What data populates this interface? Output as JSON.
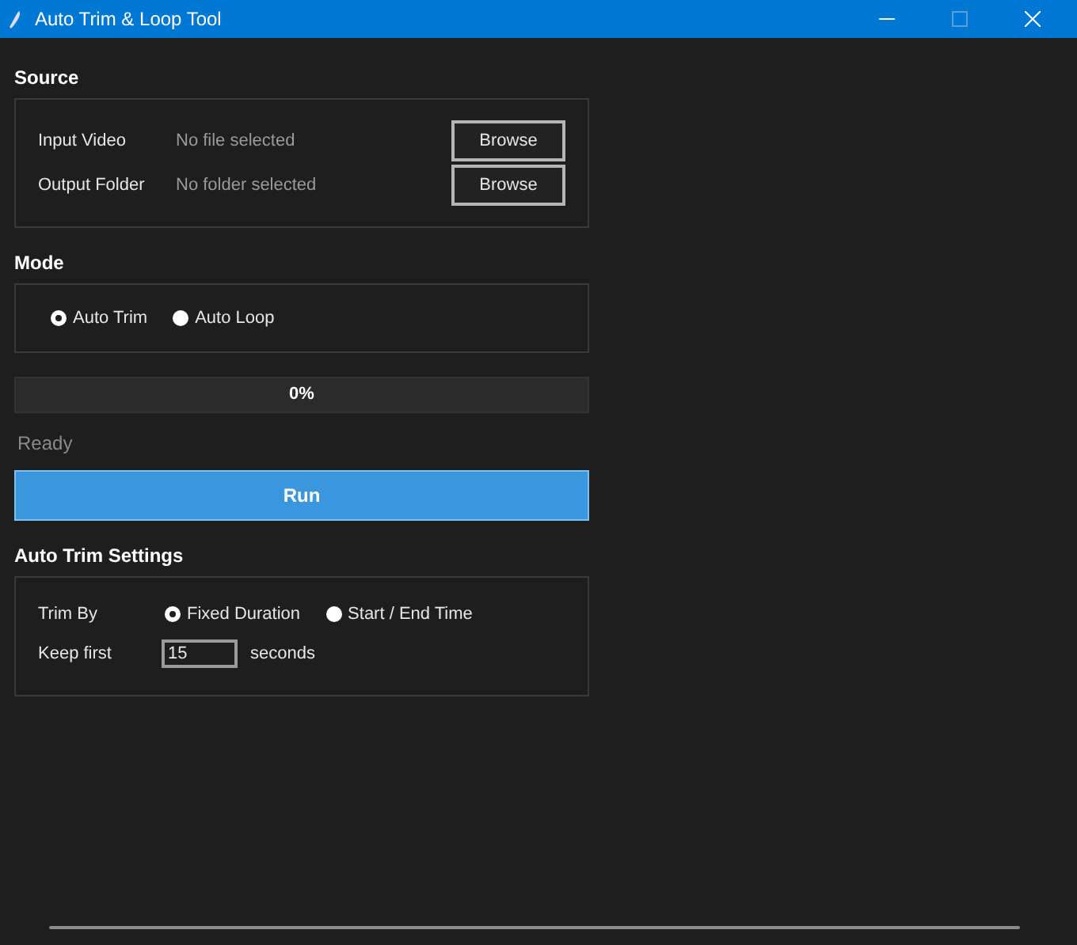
{
  "window": {
    "title": "Auto Trim & Loop Tool"
  },
  "source": {
    "title": "Source",
    "rows": [
      {
        "label": "Input Video",
        "value": "No file selected",
        "button": "Browse"
      },
      {
        "label": "Output Folder",
        "value": "No folder selected",
        "button": "Browse"
      }
    ]
  },
  "mode": {
    "title": "Mode",
    "options": [
      {
        "label": "Auto Trim",
        "selected": true
      },
      {
        "label": "Auto Loop",
        "selected": false
      }
    ]
  },
  "progress": {
    "level": 0,
    "reading": "0%"
  },
  "status": "Ready",
  "run_button": "Run",
  "settings": {
    "title": "Auto Trim Settings",
    "trim_by": {
      "label": "Trim By",
      "options": [
        {
          "label": "Fixed Duration",
          "selected": true
        },
        {
          "label": "Start / End Time",
          "selected": false
        }
      ]
    },
    "keep_first": {
      "label": "Keep first",
      "value": "15",
      "unit": "seconds"
    }
  }
}
